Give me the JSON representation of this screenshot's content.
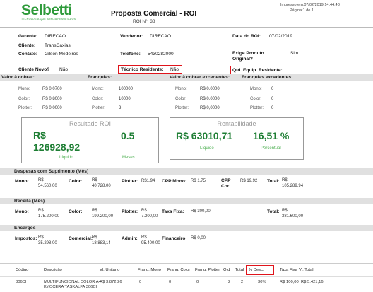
{
  "header": {
    "logo_text": "Selbetti",
    "logo_tagline": "TECNOLOGIA QUE AMPLIA RESULTADOS",
    "title": "Proposta Comercial - ROI",
    "roi_number": "ROI N°:  38",
    "printed_at": "Impresso em:07/02/2019 14:44:48",
    "page": "Página:1 de 1"
  },
  "info": {
    "gerente_label": "Gerente:",
    "gerente": "DIRECAO",
    "vendedor_label": "Vendedor:",
    "vendedor": "DIRECAO",
    "data_label": "Data do ROI:",
    "data": "07/02/2019",
    "cliente_label": "Cliente:",
    "cliente": "TransCaxias",
    "contato_label": "Contato:",
    "contato": "Gilson Medeiros",
    "telefone_label": "Telefone:",
    "telefone": "5430282000",
    "exige_label": "Exige Produto Original?",
    "exige": "Sim",
    "cliente_novo_label": "Cliente Novo?",
    "cliente_novo": "Não",
    "tecnico_label": "Técnico Residente:",
    "tecnico": "Não",
    "qtd_label": "Qtd. Equip. Residente:"
  },
  "cobrar": {
    "h_valor": "Valor à cobrar:",
    "h_franquias": "Franquias:",
    "h_valor_exc": "Valor à cobrar excedentes:",
    "h_franquias_exc": "Franquias excedentes:",
    "rows": [
      {
        "label": "Mono:",
        "valor": "R$ 0,0700",
        "f_label": "Mono:",
        "franquia": "100000",
        "e_label": "Mono:",
        "excedente": "R$ 0,0000",
        "fe_label": "Mono:",
        "fe": "0"
      },
      {
        "label": "Color:",
        "valor": "R$ 0,8000",
        "f_label": "Color:",
        "franquia": "10000",
        "e_label": "Color:",
        "excedente": "R$ 0,0000",
        "fe_label": "Color:",
        "fe": "0"
      },
      {
        "label": "Plotter:",
        "valor": "R$ 0,0000",
        "f_label": "Plotter:",
        "franquia": "3",
        "e_label": "Plotter:",
        "excedente": "R$ 0,0000",
        "fe_label": "Plotter:",
        "fe": "0"
      }
    ]
  },
  "resultado": {
    "title": "Resultado ROI",
    "liquido_currency": "R$",
    "liquido_value": "126928,92",
    "liquido_label": "Líquido",
    "meses_value": "0.5",
    "meses_label": "Meses"
  },
  "rentabilidade": {
    "title": "Rentabilidade",
    "liquido_value": "R$ 63010,71",
    "liquido_label": "Líquido",
    "percentual_value": "16,51 %",
    "percentual_label": "Percentual"
  },
  "despesas": {
    "title": "Despesas com Suprimento (Mês)",
    "mono_label": "Mono:",
    "mono_a": "R$",
    "mono_b": "54.560,00",
    "color_label": "Color:",
    "color_a": "R$",
    "color_b": "40.728,00",
    "plotter_label": "Plotter:",
    "plotter": "R$1,94",
    "cpp_mono_label": "CPP Mono:",
    "cpp_mono": "R$ 1,75",
    "cpp_cor_label_a": "CPP",
    "cpp_cor_label_b": "Cor:",
    "cpp_cor": "R$ 19,92",
    "total_label": "Total:",
    "total_a": "R$",
    "total_b": "105.289,94"
  },
  "receita": {
    "title": "Receita (Mês)",
    "mono_label": "Mono:",
    "mono_a": "R$",
    "mono_b": "175.200,00",
    "color_label": "Color:",
    "color_a": "R$",
    "color_b": "199.200,00",
    "plotter_label": "Plotter:",
    "plotter_a": "R$",
    "plotter_b": "7.200,00",
    "taxa_label": "Taxa Fixa:",
    "taxa": "R$ 300,00",
    "total_label": "Total:",
    "total_a": "R$",
    "total_b": "381.600,00"
  },
  "encargos": {
    "title": "Encargos",
    "impostos_label": "Impostos:",
    "impostos_a": "R$",
    "impostos_b": "35.298,00",
    "comercial_label": "Comercial:",
    "comercial_a": "R$",
    "comercial_b": "18.883,14",
    "admin_label": "Admin:",
    "admin_a": "R$",
    "admin_b": "95.400,00",
    "financeiro_label": "Financeiro:",
    "financeiro": "R$ 0,00"
  },
  "table": {
    "headers": {
      "codigo": "Código",
      "descricao": "Descrição",
      "vl_unitario": "Vl. Unitario",
      "franq_mono": "Franq. Mono",
      "franq_color": "Franq. Color",
      "franq_plotter": "Franq. Plotter",
      "qtd": "Qtd",
      "total": "Total",
      "desc": "% Desc.",
      "taxa_fixa": "Taxa Fixa",
      "vl_total": "Vl. Total"
    },
    "row": {
      "codigo": "306CI",
      "descricao_1": "MULTIFUNCIONAL COLOR A4",
      "descricao_2": "KYOCERA TASKALFA 306CI",
      "vl_unitario": "R$ 3.872,26",
      "franq_mono": "0",
      "franq_color": "0",
      "franq_plotter": "0",
      "qtd": "2",
      "total": "2",
      "desc": "30%",
      "taxa_fixa": "R$ 100,00",
      "vl_total": "R$ 5.421,16"
    }
  },
  "colors": {
    "brand_green": "#2e9a3a",
    "highlight_red": "#e0141b",
    "section_gray": "#e0e0e0"
  }
}
